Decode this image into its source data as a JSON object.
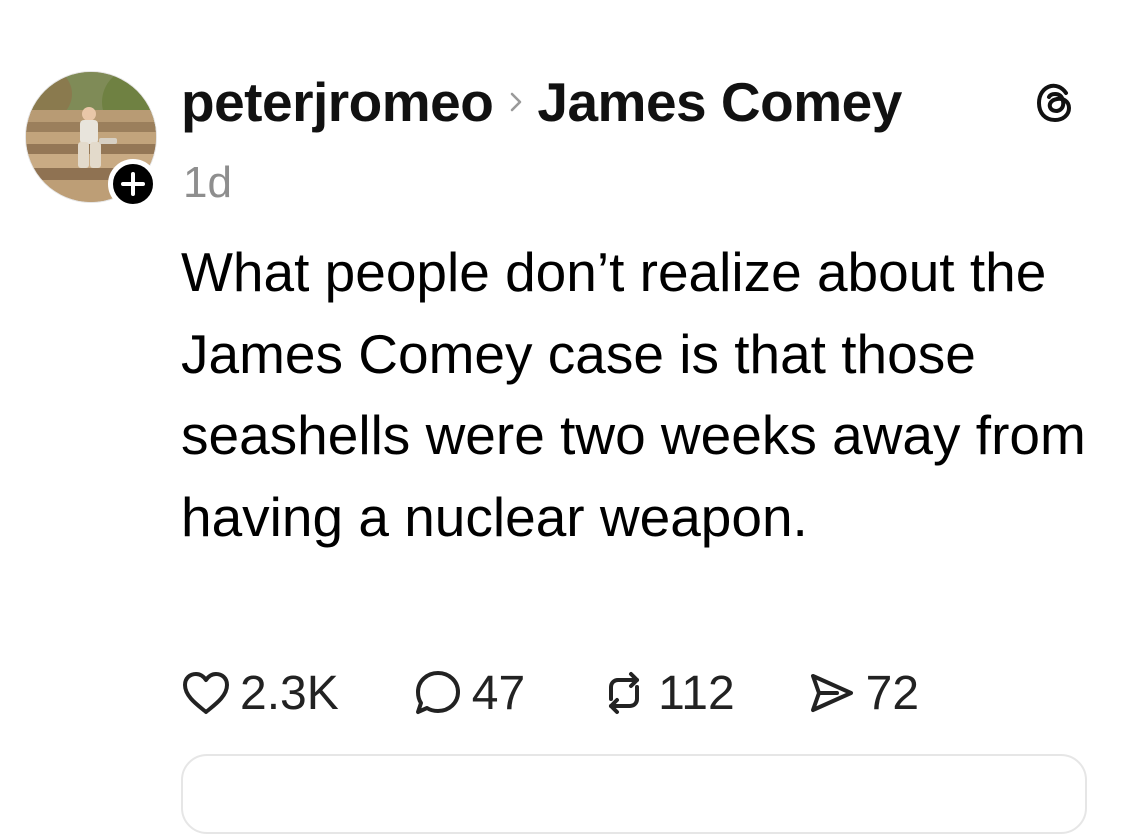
{
  "post": {
    "username": "peterjromeo",
    "topic": "James Comey",
    "timestamp": "1d",
    "text": "What people don’t realize about the James Comey case is that those seashells were two weeks away from having a nuclear weapon.",
    "avatar_icon": "user-avatar-photo",
    "follow_icon": "plus-icon",
    "topic_separator_icon": "chevron-right-icon",
    "app_icon": "threads-logo-icon"
  },
  "actions": {
    "like": {
      "icon": "heart-icon",
      "count": "2.3K"
    },
    "reply": {
      "icon": "comment-icon",
      "count": "47"
    },
    "repost": {
      "icon": "repost-icon",
      "count": "112"
    },
    "share": {
      "icon": "send-icon",
      "count": "72"
    }
  },
  "colors": {
    "text": "#000000",
    "secondary_text": "#8e8e8e",
    "badge": "#000000",
    "border": "#e6e6e6"
  }
}
